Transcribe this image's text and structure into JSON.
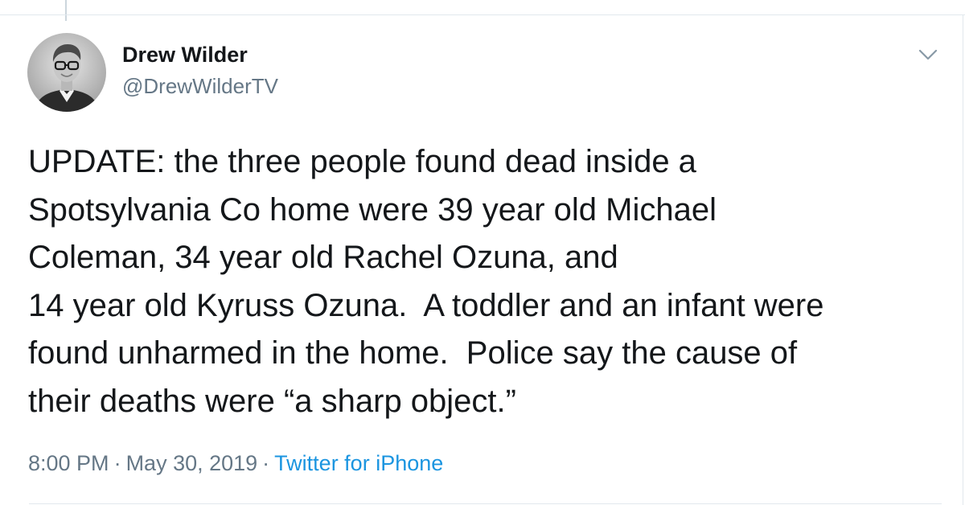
{
  "tweet": {
    "author": {
      "display_name": "Drew Wilder",
      "handle": "@DrewWilderTV"
    },
    "text_lines": [
      "UPDATE: the three people found dead inside a",
      "Spotsylvania Co home were 39 year old Michael",
      "Coleman, 34 year old Rachel Ozuna, and",
      "14 year old Kyruss Ozuna.  A toddler and an infant were",
      "found unharmed in the home.  Police say the cause of",
      "their deaths were “a sharp object.”"
    ],
    "time": "8:00 PM",
    "separator": "·",
    "date": "May 30, 2019",
    "source": "Twitter for iPhone"
  },
  "icons": {
    "menu": "chevron-down-icon",
    "avatar": "avatar"
  },
  "colors": {
    "text_primary": "#14171a",
    "text_secondary": "#657786",
    "link": "#1b95e0",
    "border": "#e1e8ed",
    "thread_line": "#ccd6dd"
  }
}
